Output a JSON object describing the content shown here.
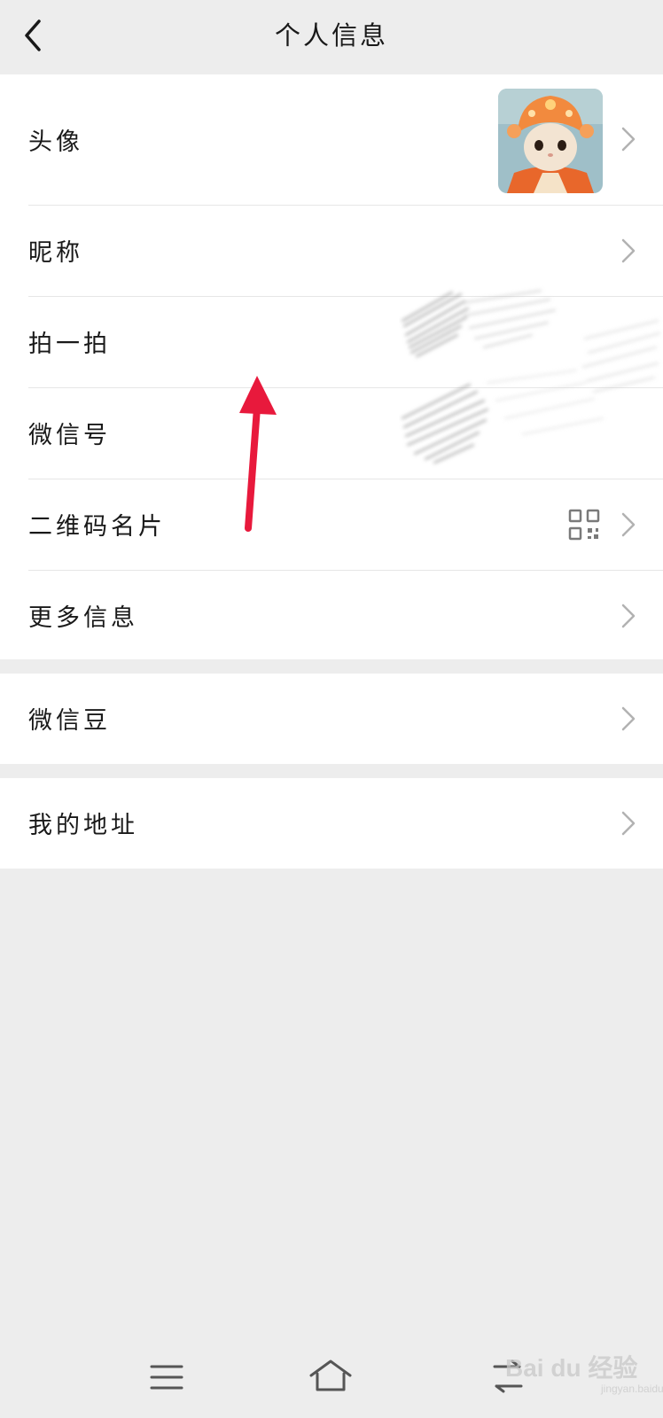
{
  "header": {
    "title": "个人信息"
  },
  "rows": {
    "avatar": {
      "label": "头像"
    },
    "nickname": {
      "label": "昵称"
    },
    "pat": {
      "label": "拍一拍"
    },
    "wechat_id": {
      "label": "微信号"
    },
    "qr_card": {
      "label": "二维码名片"
    },
    "more_info": {
      "label": "更多信息"
    },
    "wechat_beans": {
      "label": "微信豆"
    },
    "my_address": {
      "label": "我的地址"
    }
  },
  "icons": {
    "back": "chevron-left-icon",
    "chevron": "chevron-right-icon",
    "qr": "qr-code-icon",
    "menu": "menu-icon",
    "home": "home-icon",
    "recent": "recent-apps-icon"
  },
  "colors": {
    "page_background": "#ededed",
    "row_background": "#ffffff",
    "annotation_arrow": "#e8193c",
    "chevron": "#b2b2b2"
  },
  "watermark": {
    "text": "Bai du 经验",
    "sub": "jingyan.baidu.com"
  }
}
